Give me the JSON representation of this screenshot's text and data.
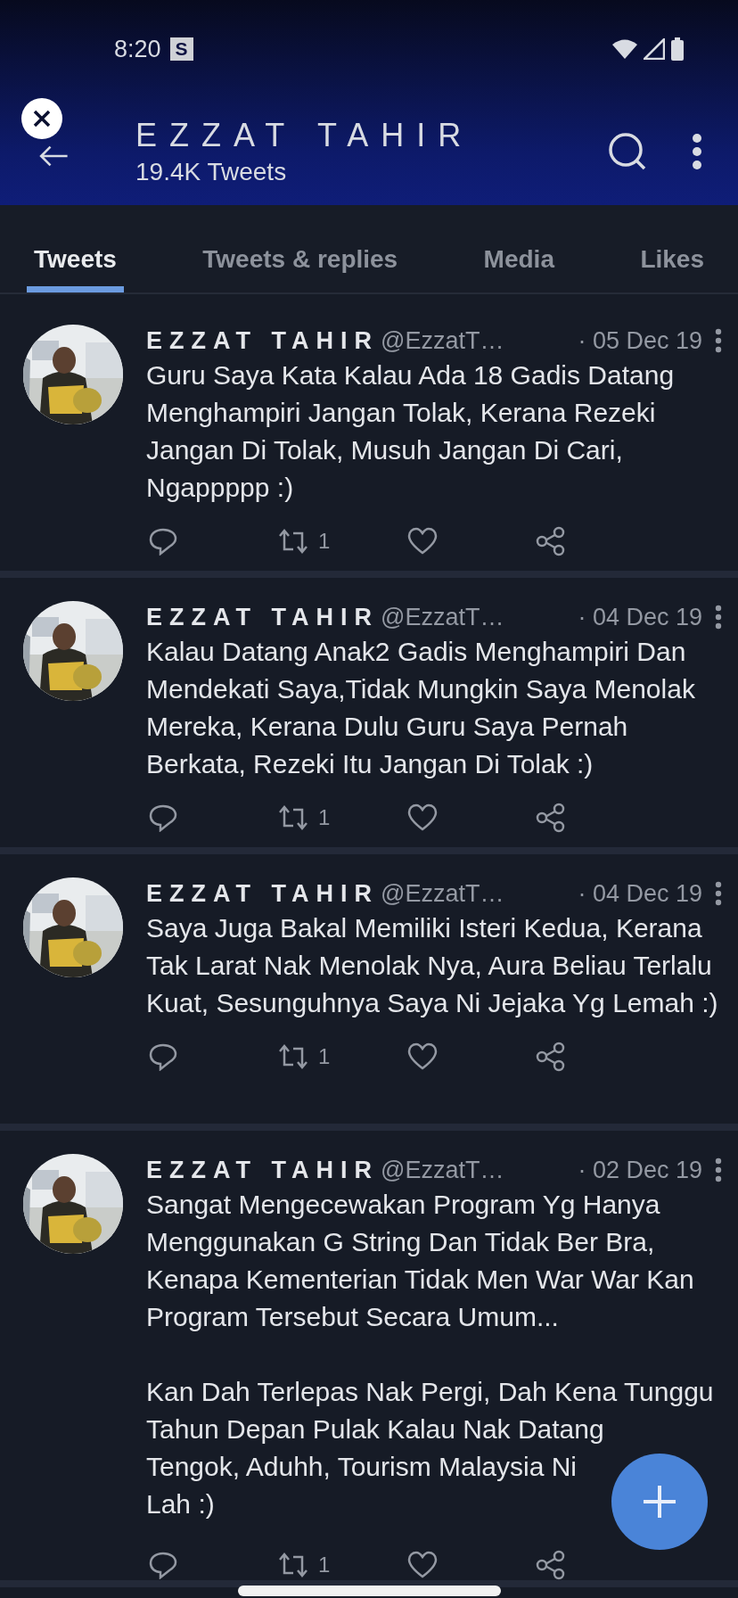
{
  "status_bar": {
    "time": "8:20",
    "badge": "S"
  },
  "header": {
    "title": "EZZAT TAHIR",
    "subtitle": "19.4K Tweets"
  },
  "tabs": [
    {
      "label": "Tweets",
      "selected": true
    },
    {
      "label": "Tweets & replies",
      "selected": false
    },
    {
      "label": "Media",
      "selected": false
    },
    {
      "label": "Likes",
      "selected": false
    }
  ],
  "tweets": [
    {
      "name": "EZZAT TAHIR",
      "handle": "@EzzatT…",
      "date": "· 05 Dec 19",
      "paragraphs": [
        "Guru Saya Kata Kalau Ada 18 Gadis Datang Menghampiri Jangan Tolak, Kerana Rezeki Jangan Di Tolak, Musuh Jangan Di Cari, Ngappppp :)"
      ],
      "retweets": "1"
    },
    {
      "name": "EZZAT TAHIR",
      "handle": "@EzzatT…",
      "date": "· 04 Dec 19",
      "paragraphs": [
        "Kalau Datang Anak2 Gadis Menghampiri Dan Mendekati Saya,Tidak Mungkin Saya Menolak Mereka, Kerana Dulu Guru Saya Pernah Berkata, Rezeki Itu Jangan Di Tolak :)"
      ],
      "retweets": "1"
    },
    {
      "name": "EZZAT TAHIR",
      "handle": "@EzzatT…",
      "date": "· 04 Dec 19",
      "paragraphs": [
        "Saya Juga Bakal Memiliki Isteri Kedua, Kerana Tak Larat Nak Menolak Nya, Aura Beliau Terlalu Kuat, Sesunguhnya Saya Ni Jejaka Yg Lemah :)"
      ],
      "retweets": "1"
    },
    {
      "name": "EZZAT TAHIR",
      "handle": "@EzzatT…",
      "date": "· 02 Dec 19",
      "paragraphs": [
        "Sangat Mengecewakan Program Yg Hanya Menggunakan G String Dan Tidak Ber Bra, Kenapa Kementerian Tidak Men War War Kan Program Tersebut Secara Umum...",
        "Kan Dah Terlepas Nak Pergi, Dah Kena Tunggu Tahun Depan Pulak Kalau Nak Datang",
        "Tengok, Aduhh, Tourism Malaysia Ni",
        "Lah :)"
      ],
      "retweets": "1"
    }
  ]
}
